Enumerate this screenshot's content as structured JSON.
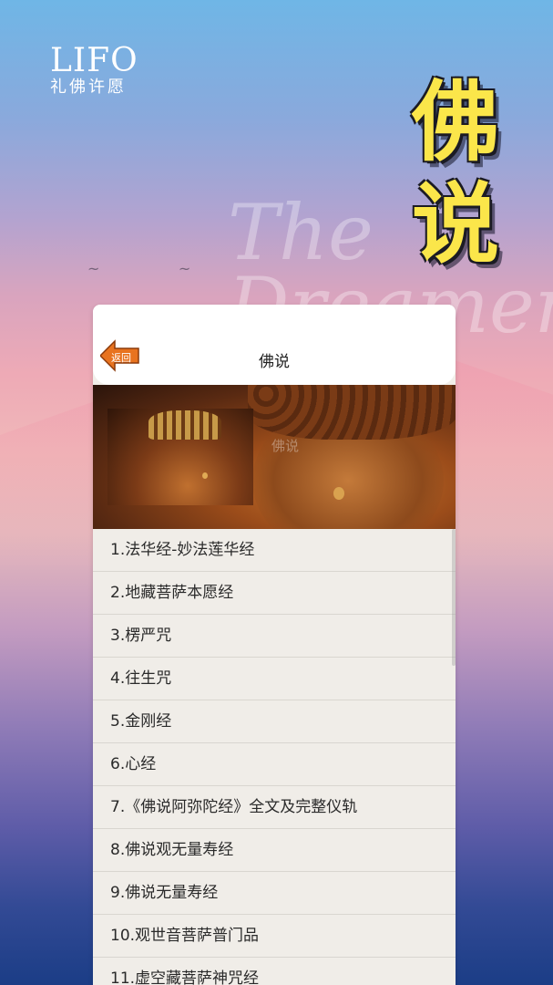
{
  "logo": {
    "main": "LIFO",
    "sub": "礼佛许愿"
  },
  "hero_title": "佛说",
  "watermark": "The Dreamer",
  "header": {
    "back_label": "返回",
    "title": "佛说"
  },
  "banner": {
    "overlay_text": "佛说"
  },
  "list": [
    "1.法华经-妙法莲华经",
    "2.地藏菩萨本愿经",
    "3.楞严咒",
    "4.往生咒",
    "5.金刚经",
    "6.心经",
    "7.《佛说阿弥陀经》全文及完整仪轨",
    "8.佛说观无量寿经",
    "9.佛说无量寿经",
    "10.观世音菩萨普门品",
    "11.虚空藏菩萨神咒经"
  ],
  "colors": {
    "hero_title": "#fbe64a",
    "back_button": "#e8731f"
  }
}
